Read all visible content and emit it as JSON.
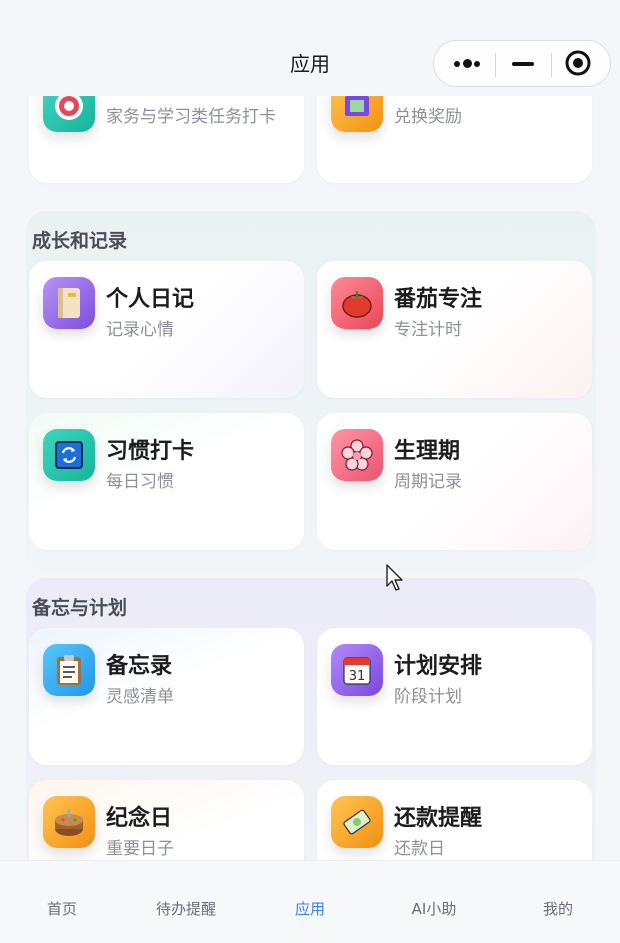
{
  "nav": {
    "title": "应用"
  },
  "top_partial": [
    {
      "subtitle": "家务与学习类任务打卡",
      "icon": "target-icon"
    },
    {
      "subtitle": "兑换奖励",
      "icon": "gift-icon"
    }
  ],
  "sections": [
    {
      "title": "成长和记录",
      "cards": [
        {
          "title": "个人日记",
          "subtitle": "记录心情",
          "icon": "notebook-icon"
        },
        {
          "title": "番茄专注",
          "subtitle": "专注计时",
          "icon": "tomato-icon"
        },
        {
          "title": "习惯打卡",
          "subtitle": "每日习惯",
          "icon": "repeat-icon"
        },
        {
          "title": "生理期",
          "subtitle": "周期记录",
          "icon": "flower-icon"
        }
      ]
    },
    {
      "title": "备忘与计划",
      "cards": [
        {
          "title": "备忘录",
          "subtitle": "灵感清单",
          "icon": "clipboard-icon"
        },
        {
          "title": "计划安排",
          "subtitle": "阶段计划",
          "icon": "calendar-icon",
          "calendar_day": "31"
        },
        {
          "title": "纪念日",
          "subtitle": "重要日子",
          "icon": "cake-icon"
        },
        {
          "title": "还款提醒",
          "subtitle": "还款日",
          "icon": "money-icon"
        }
      ]
    }
  ],
  "tabs": [
    {
      "label": "首页",
      "active": false
    },
    {
      "label": "待办提醒",
      "active": false
    },
    {
      "label": "应用",
      "active": true
    },
    {
      "label": "AI小助",
      "active": false
    },
    {
      "label": "我的",
      "active": false
    }
  ],
  "colors": {
    "accent": "#3b7ef5",
    "text_secondary": "#8e9099"
  }
}
